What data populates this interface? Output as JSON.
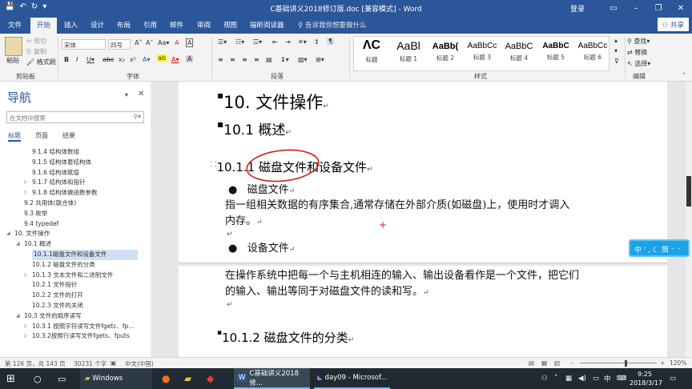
{
  "window": {
    "title": "C基础讲义2018修订版.doc [兼容模式] - Word",
    "login": "登录",
    "share": "共享",
    "quick_access": [
      "save-icon",
      "undo-icon",
      "redo-icon"
    ]
  },
  "ribbon_tabs": [
    "文件",
    "开始",
    "插入",
    "设计",
    "布局",
    "引用",
    "邮件",
    "审阅",
    "视图",
    "福昕阅读器"
  ],
  "active_tab": "开始",
  "tell_me": "告诉我你想要做什么",
  "clipboard": {
    "paste": "粘贴",
    "cut": "剪切",
    "copy": "复制",
    "format_painter": "格式刷",
    "group": "剪贴板"
  },
  "font": {
    "name": "宋体",
    "size": "四号",
    "group": "字体"
  },
  "paragraph": {
    "group": "段落"
  },
  "styles": {
    "group": "样式",
    "items": [
      {
        "preview": "ɅC",
        "label": "标题"
      },
      {
        "preview": "AaBl",
        "label": "标题 1"
      },
      {
        "preview": "AaBb(",
        "label": "标题 2"
      },
      {
        "preview": "AaBbCc",
        "label": "标题 3"
      },
      {
        "preview": "AaBbC",
        "label": "标题 4"
      },
      {
        "preview": "AaBbC",
        "label": "标题 5"
      },
      {
        "preview": "AaBbCc",
        "label": "标题 6"
      }
    ]
  },
  "editing": {
    "find": "查找",
    "replace": "替换",
    "select": "选择",
    "group": "编辑"
  },
  "navigation": {
    "title": "导航",
    "search_placeholder": "在文档中搜索",
    "tabs": [
      "标题",
      "页面",
      "结果"
    ],
    "items": [
      {
        "text": "9.1.4 结构体数组",
        "indent": 3
      },
      {
        "text": "9.1.5 结构体套结构体",
        "indent": 3
      },
      {
        "text": "9.1.6 结构体赋值",
        "indent": 3
      },
      {
        "text": "9.1.7 结构体和指针",
        "indent": 3,
        "arrow": "▷"
      },
      {
        "text": "9.1.8 结构体做函数参数",
        "indent": 3,
        "arrow": "▷"
      },
      {
        "text": "9.2 共用体(联合体)",
        "indent": 2
      },
      {
        "text": "9.3 枚举",
        "indent": 2
      },
      {
        "text": "9.4 typedef",
        "indent": 2
      },
      {
        "text": "10. 文件操作",
        "indent": 1,
        "arrow": "◢"
      },
      {
        "text": "10.1 概述",
        "indent": 2,
        "arrow": "◢"
      },
      {
        "text": "10.1.1磁盘文件和设备文件",
        "indent": 3,
        "selected": true
      },
      {
        "text": "10.1.2 磁盘文件的分类",
        "indent": 3
      },
      {
        "text": "10.1.3 文本文件和二进制文件",
        "indent": 3,
        "arrow": "▷"
      },
      {
        "text": "10.2.1 文件指针",
        "indent": 3
      },
      {
        "text": "10.2.2 文件的打开",
        "indent": 3
      },
      {
        "text": "10.2.3 文件的关闭",
        "indent": 3
      },
      {
        "text": "10.3 文件的顺序读写",
        "indent": 2,
        "arrow": "◢"
      },
      {
        "text": "10.3.1 按照字符读写文件fgetc、fp...",
        "indent": 3,
        "arrow": "▷"
      },
      {
        "text": "10.3.2按照行读写文件fgets、fputs",
        "indent": 3,
        "arrow": "▷"
      }
    ]
  },
  "document": {
    "h_ch10": "10. 文件操作",
    "h_101": "10.1 概述",
    "h_1011": "10.1.1 磁盘文件和设备文件",
    "bullet1": "磁盘文件",
    "p1_line1": "指一组相关数据的有序集合,通常存储在外部介质(如磁盘)上，使用时才调入",
    "p1_line2": "内存。",
    "bullet2": "设备文件",
    "p2_line1": "在操作系统中把每一个与主机相连的输入、输出设备看作是一个文件，把它们",
    "p2_line2": "的输入、输出等同于对磁盘文件的读和写。",
    "h_1012": "10.1.2 磁盘文件的分类"
  },
  "status": {
    "page": "第 126 页，共 143 页",
    "words": "30231 个字",
    "lang": "中文(中国)",
    "zoom": "120%"
  },
  "ime": {
    "text": "中 ' , ☾ 简 ⁻ ⁻"
  },
  "taskbar": {
    "windows": "Windows",
    "word_task": "C基础讲义2018修...",
    "vs_task": "day09 - Microsof...",
    "ime": "中",
    "time": "9:25",
    "date": "2018/3/17"
  },
  "colors": {
    "accent": "#2b579a",
    "annotation": "#d02020",
    "taskbar": "#1f2a33"
  }
}
